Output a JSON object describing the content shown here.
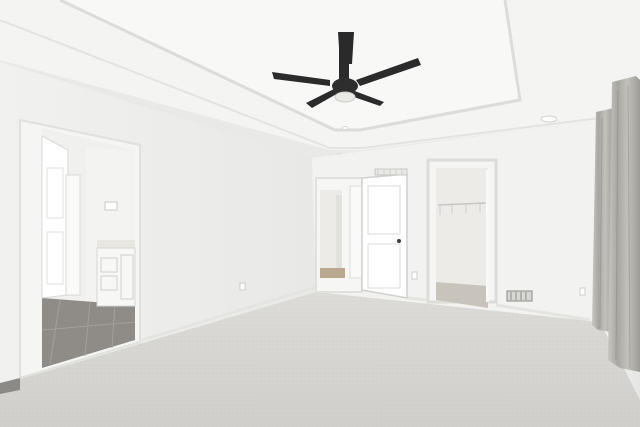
{
  "image": {
    "subject": "empty-bedroom-interior",
    "colors": {
      "ceiling": "#f4f4f2",
      "tray_ceiling": "#f7f7f5",
      "wall_left": "#efefed",
      "wall_back": "#f2f2f0",
      "wall_right": "#eeeeec",
      "carpet": "#d6d5d1",
      "tile": "#8f8b86",
      "fan_dark": "#2b2b2b",
      "curtain": "#b7b5b0"
    },
    "features": [
      "ceiling-fan",
      "tray-ceiling",
      "recessed-lights",
      "bathroom-doorway",
      "hall-door",
      "walk-in-closet",
      "window-curtains",
      "floor-vents"
    ]
  }
}
